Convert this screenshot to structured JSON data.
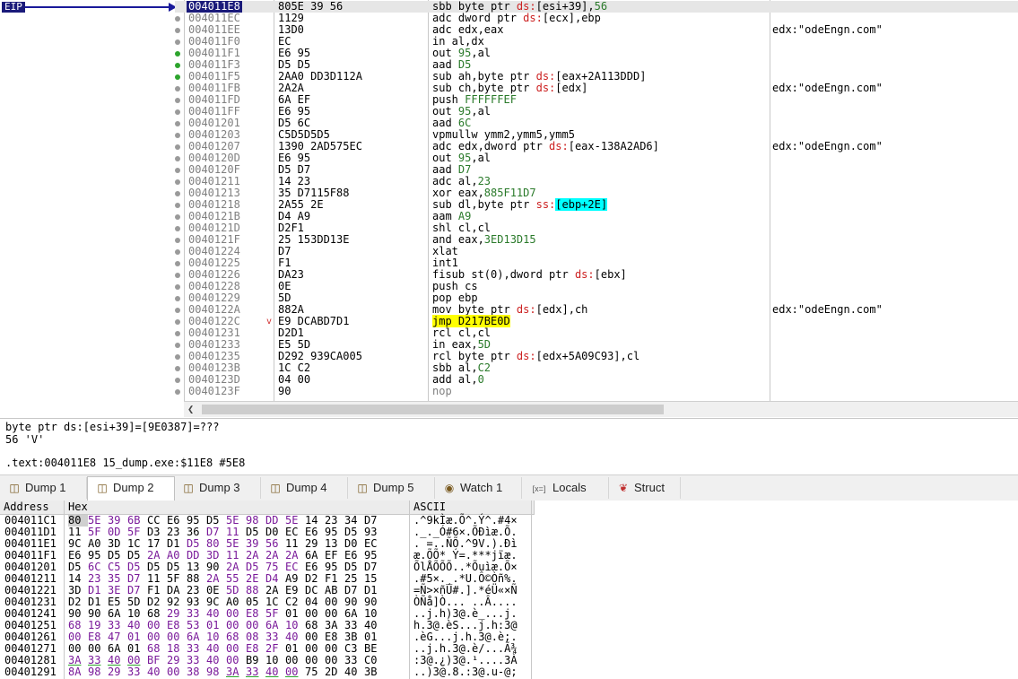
{
  "eip_label": "EIP",
  "rows": [
    {
      "addr": "004011E8",
      "bytes": "805E 39 56",
      "pre": "sbb byte ptr ",
      "seg": "ds:",
      "mem": "[esi+39]",
      "post": ",",
      "num": "56",
      "cmt": "",
      "dot": "none",
      "sel": true
    },
    {
      "addr": "004011EC",
      "bytes": "1129",
      "pre": "adc dword ptr ",
      "seg": "ds:",
      "mem": "[ecx]",
      "post": ",ebp",
      "num": "",
      "cmt": "",
      "dot": "gray"
    },
    {
      "addr": "004011EE",
      "bytes": "13D0",
      "pre": "adc edx,eax",
      "seg": "",
      "mem": "",
      "post": "",
      "num": "",
      "cmt": "edx:\"odeEngn.com\"",
      "dot": "gray"
    },
    {
      "addr": "004011F0",
      "bytes": "EC",
      "pre": "in al,dx",
      "seg": "",
      "mem": "",
      "post": "",
      "num": "",
      "cmt": "",
      "dot": "gray"
    },
    {
      "addr": "004011F1",
      "bytes": "E6 95",
      "pre": "out ",
      "seg": "",
      "mem": "",
      "post": "",
      "num": "95",
      "post2": ",al",
      "cmt": "",
      "dot": "green"
    },
    {
      "addr": "004011F3",
      "bytes": "D5 D5",
      "pre": "aad ",
      "seg": "",
      "mem": "",
      "post": "",
      "num": "D5",
      "cmt": "",
      "dot": "green"
    },
    {
      "addr": "004011F5",
      "bytes": "2AA0 DD3D112A",
      "pre": "sub ah,byte ptr ",
      "seg": "ds:",
      "mem": "[eax+2A113DDD]",
      "post": "",
      "num": "",
      "cmt": "",
      "dot": "green"
    },
    {
      "addr": "004011FB",
      "bytes": "2A2A",
      "pre": "sub ch,byte ptr ",
      "seg": "ds:",
      "mem": "[edx]",
      "post": "",
      "num": "",
      "cmt": "edx:\"odeEngn.com\"",
      "dot": "gray"
    },
    {
      "addr": "004011FD",
      "bytes": "6A EF",
      "pre": "push ",
      "seg": "",
      "mem": "",
      "post": "",
      "num": "FFFFFFEF",
      "cmt": "",
      "dot": "gray"
    },
    {
      "addr": "004011FF",
      "bytes": "E6 95",
      "pre": "out ",
      "seg": "",
      "mem": "",
      "post": "",
      "num": "95",
      "post2": ",al",
      "cmt": "",
      "dot": "gray"
    },
    {
      "addr": "00401201",
      "bytes": "D5 6C",
      "pre": "aad ",
      "seg": "",
      "mem": "",
      "post": "",
      "num": "6C",
      "cmt": "",
      "dot": "gray"
    },
    {
      "addr": "00401203",
      "bytes": "C5D5D5D5",
      "pre": "vpmullw ymm2,ymm5,ymm5",
      "seg": "",
      "mem": "",
      "post": "",
      "num": "",
      "cmt": "",
      "dot": "gray"
    },
    {
      "addr": "00401207",
      "bytes": "1390 2AD575EC",
      "pre": "adc edx,dword ptr ",
      "seg": "ds:",
      "mem": "[eax-138A2AD6]",
      "post": "",
      "num": "",
      "cmt": "edx:\"odeEngn.com\"",
      "dot": "gray"
    },
    {
      "addr": "0040120D",
      "bytes": "E6 95",
      "pre": "out ",
      "seg": "",
      "mem": "",
      "post": "",
      "num": "95",
      "post2": ",al",
      "cmt": "",
      "dot": "gray"
    },
    {
      "addr": "0040120F",
      "bytes": "D5 D7",
      "pre": "aad ",
      "seg": "",
      "mem": "",
      "post": "",
      "num": "D7",
      "cmt": "",
      "dot": "gray"
    },
    {
      "addr": "00401211",
      "bytes": "14 23",
      "pre": "adc al,",
      "seg": "",
      "mem": "",
      "post": "",
      "num": "23",
      "cmt": "",
      "dot": "gray"
    },
    {
      "addr": "00401213",
      "bytes": "35 D7115F88",
      "pre": "xor eax,",
      "seg": "",
      "mem": "",
      "post": "",
      "num": "885F11D7",
      "cmt": "",
      "dot": "gray"
    },
    {
      "addr": "00401218",
      "bytes": "2A55 2E",
      "pre": "sub dl,byte ptr ",
      "seg": "ss:",
      "mem": "[ebp+2E]",
      "post": "",
      "num": "",
      "cmt": "",
      "dot": "gray",
      "cyan": true
    },
    {
      "addr": "0040121B",
      "bytes": "D4 A9",
      "pre": "aam ",
      "seg": "",
      "mem": "",
      "post": "",
      "num": "A9",
      "cmt": "",
      "dot": "gray"
    },
    {
      "addr": "0040121D",
      "bytes": "D2F1",
      "pre": "shl cl,cl",
      "seg": "",
      "mem": "",
      "post": "",
      "num": "",
      "cmt": "",
      "dot": "gray"
    },
    {
      "addr": "0040121F",
      "bytes": "25 153DD13E",
      "pre": "and eax,",
      "seg": "",
      "mem": "",
      "post": "",
      "num": "3ED13D15",
      "cmt": "",
      "dot": "gray"
    },
    {
      "addr": "00401224",
      "bytes": "D7",
      "pre": "xlat",
      "seg": "",
      "mem": "",
      "post": "",
      "num": "",
      "cmt": "",
      "dot": "gray"
    },
    {
      "addr": "00401225",
      "bytes": "F1",
      "pre": "int1",
      "seg": "",
      "mem": "",
      "post": "",
      "num": "",
      "cmt": "",
      "dot": "gray"
    },
    {
      "addr": "00401226",
      "bytes": "DA23",
      "pre": "fisub st(0),dword ptr ",
      "seg": "ds:",
      "mem": "[ebx]",
      "post": "",
      "num": "",
      "cmt": "",
      "dot": "gray"
    },
    {
      "addr": "00401228",
      "bytes": "0E",
      "pre": "push cs",
      "seg": "",
      "mem": "",
      "post": "",
      "num": "",
      "cmt": "",
      "dot": "gray"
    },
    {
      "addr": "00401229",
      "bytes": "5D",
      "pre": "pop ebp",
      "seg": "",
      "mem": "",
      "post": "",
      "num": "",
      "cmt": "",
      "dot": "gray"
    },
    {
      "addr": "0040122A",
      "bytes": "882A",
      "pre": "mov byte ptr ",
      "seg": "ds:",
      "mem": "[edx]",
      "post": ",ch",
      "num": "",
      "cmt": "edx:\"odeEngn.com\"",
      "dot": "gray"
    },
    {
      "addr": "0040122C",
      "bytes": "E9 DCABD7D1",
      "pre": "",
      "seg": "",
      "mem": "",
      "post": "",
      "num": "",
      "jmp": "jmp D217BE0D",
      "cmt": "",
      "dot": "gray",
      "chev": "v"
    },
    {
      "addr": "00401231",
      "bytes": "D2D1",
      "pre": "rcl cl,cl",
      "seg": "",
      "mem": "",
      "post": "",
      "num": "",
      "cmt": "",
      "dot": "gray"
    },
    {
      "addr": "00401233",
      "bytes": "E5 5D",
      "pre": "in eax,",
      "seg": "",
      "mem": "",
      "post": "",
      "num": "5D",
      "cmt": "",
      "dot": "gray"
    },
    {
      "addr": "00401235",
      "bytes": "D292 939CA005",
      "pre": "rcl byte ptr ",
      "seg": "ds:",
      "mem": "[edx+5A09C93]",
      "post": ",cl",
      "num": "",
      "cmt": "",
      "dot": "gray"
    },
    {
      "addr": "0040123B",
      "bytes": "1C C2",
      "pre": "sbb al,",
      "seg": "",
      "mem": "",
      "post": "",
      "num": "C2",
      "cmt": "",
      "dot": "gray"
    },
    {
      "addr": "0040123D",
      "bytes": "04 00",
      "pre": "add al,",
      "seg": "",
      "mem": "",
      "post": "",
      "num": "0",
      "cmt": "",
      "dot": "gray"
    },
    {
      "addr": "0040123F",
      "bytes": "90",
      "pre": "nop",
      "seg": "",
      "mem": "",
      "post": "",
      "num": "",
      "cmt": "",
      "dot": "gray",
      "nop": true
    }
  ],
  "info": {
    "line1": "byte ptr ds:[esi+39]=[9E0387]=???",
    "line2": "56 'V'",
    "line3": ".text:004011E8 15_dump.exe:$11E8 #5E8"
  },
  "tabs": [
    {
      "label": "Dump 1",
      "icon": "dump-icon"
    },
    {
      "label": "Dump 2",
      "icon": "dump-icon",
      "active": true
    },
    {
      "label": "Dump 3",
      "icon": "dump-icon"
    },
    {
      "label": "Dump 4",
      "icon": "dump-icon"
    },
    {
      "label": "Dump 5",
      "icon": "dump-icon"
    },
    {
      "label": "Watch 1",
      "icon": "watch-icon"
    },
    {
      "label": "Locals",
      "icon": "locals-icon"
    },
    {
      "label": "Struct",
      "icon": "struct-icon"
    }
  ],
  "dump": {
    "headers": {
      "address": "Address",
      "hex": "Hex",
      "ascii": "ASCII"
    },
    "rows": [
      {
        "addr": "004011C1",
        "hex": [
          "80",
          "5E",
          "39",
          "6B",
          "CC",
          "E6",
          "95",
          "D5",
          "5E",
          "98",
          "DD",
          "5E",
          "14",
          "23",
          "34",
          "D7"
        ],
        "ascii": ".^9kÌæ.Õ^.Ý^.#4×"
      },
      {
        "addr": "004011D1",
        "hex": [
          "11",
          "5F",
          "0D",
          "5F",
          "D3",
          "23",
          "36",
          "D7",
          "11",
          "D5",
          "D0",
          "EC",
          "E6",
          "95",
          "D5",
          "93"
        ],
        "ascii": "._._Ó#6×.ÕÐìæ.Õ."
      },
      {
        "addr": "004011E1",
        "hex": [
          "9C",
          "A0",
          "3D",
          "1C",
          "17",
          "D1",
          "D5",
          "80",
          "5E",
          "39",
          "56",
          "11",
          "29",
          "13",
          "D0",
          "EC"
        ],
        "ascii": ". =..ÑÕ.^9V.).Ðì"
      },
      {
        "addr": "004011F1",
        "hex": [
          "E6",
          "95",
          "D5",
          "D5",
          "2A",
          "A0",
          "DD",
          "3D",
          "11",
          "2A",
          "2A",
          "2A",
          "6A",
          "EF",
          "E6",
          "95"
        ],
        "ascii": "æ.ÕÕ* Ý=.***jïæ."
      },
      {
        "addr": "00401201",
        "hex": [
          "D5",
          "6C",
          "C5",
          "D5",
          "D5",
          "D5",
          "13",
          "90",
          "2A",
          "D5",
          "75",
          "EC",
          "E6",
          "95",
          "D5",
          "D7"
        ],
        "ascii": "ÕlÅÕÕÕ..*Õuìæ.Õ×"
      },
      {
        "addr": "00401211",
        "hex": [
          "14",
          "23",
          "35",
          "D7",
          "11",
          "5F",
          "88",
          "2A",
          "55",
          "2E",
          "D4",
          "A9",
          "D2",
          "F1",
          "25",
          "15"
        ],
        "ascii": ".#5×._.*U.Ô©Òñ%."
      },
      {
        "addr": "00401221",
        "hex": [
          "3D",
          "D1",
          "3E",
          "D7",
          "F1",
          "DA",
          "23",
          "0E",
          "5D",
          "88",
          "2A",
          "E9",
          "DC",
          "AB",
          "D7",
          "D1"
        ],
        "ascii": "=Ñ>×ñÚ#.].*éÜ«×Ñ"
      },
      {
        "addr": "00401231",
        "hex": [
          "D2",
          "D1",
          "E5",
          "5D",
          "D2",
          "92",
          "93",
          "9C",
          "A0",
          "05",
          "1C",
          "C2",
          "04",
          "00",
          "90",
          "90"
        ],
        "ascii": "ÒÑå]Ò... ..Â...."
      },
      {
        "addr": "00401241",
        "hex": [
          "90",
          "90",
          "6A",
          "10",
          "68",
          "29",
          "33",
          "40",
          "00",
          "E8",
          "5F",
          "01",
          "00",
          "00",
          "6A",
          "10"
        ],
        "ascii": "..j.h)3@.è_...j."
      },
      {
        "addr": "00401251",
        "hex": [
          "68",
          "19",
          "33",
          "40",
          "00",
          "E8",
          "53",
          "01",
          "00",
          "00",
          "6A",
          "10",
          "68",
          "3A",
          "33",
          "40"
        ],
        "ascii": "h.3@.èS...j.h:3@"
      },
      {
        "addr": "00401261",
        "hex": [
          "00",
          "E8",
          "47",
          "01",
          "00",
          "00",
          "6A",
          "10",
          "68",
          "08",
          "33",
          "40",
          "00",
          "E8",
          "3B",
          "01"
        ],
        "ascii": ".èG...j.h.3@.è;."
      },
      {
        "addr": "00401271",
        "hex": [
          "00",
          "00",
          "6A",
          "01",
          "68",
          "18",
          "33",
          "40",
          "00",
          "E8",
          "2F",
          "01",
          "00",
          "00",
          "C3",
          "BE"
        ],
        "ascii": "..j.h.3@.è/...Ã¾"
      },
      {
        "addr": "00401281",
        "hex": [
          "3A",
          "33",
          "40",
          "00",
          "BF",
          "29",
          "33",
          "40",
          "00",
          "B9",
          "10",
          "00",
          "00",
          "00",
          "33",
          "C0"
        ],
        "ascii": ":3@.¿)3@.¹....3À"
      },
      {
        "addr": "00401291",
        "hex": [
          "8A",
          "98",
          "29",
          "33",
          "40",
          "00",
          "38",
          "98",
          "3A",
          "33",
          "40",
          "00",
          "75",
          "2D",
          "40",
          "3B"
        ],
        "ascii": "..)3@.8.:3@.u-@;"
      }
    ]
  }
}
